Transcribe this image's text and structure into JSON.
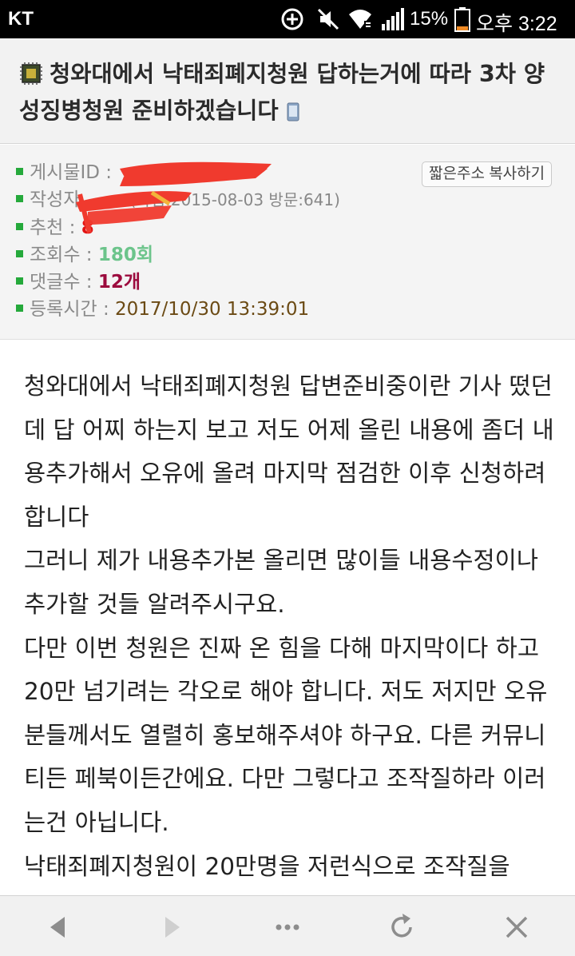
{
  "status_bar": {
    "carrier": "KT",
    "battery_percent": "15%",
    "time": "오후 3:22",
    "icons": [
      "data-saver-icon",
      "mute-icon",
      "wifi-icon",
      "signal-icon",
      "battery-icon"
    ]
  },
  "post": {
    "title": "청와대에서 낙태죄폐지청원 답하는거에 따라 3차 양성징병청원 준비하겠습니다",
    "meta": {
      "post_id_label": "게시물ID :",
      "author_label": "작성자",
      "author_info": "(가입:2015-08-03 방문:641)",
      "recommend_label": "추천 :",
      "recommend_value": "8",
      "views_label": "조회수 :",
      "views_value": "180회",
      "comments_label": "댓글수 :",
      "comments_value": "12개",
      "date_label": "등록시간 :",
      "date_value": "2017/10/30 13:39:01",
      "short_url_button": "짧은주소 복사하기"
    },
    "body_paragraphs": [
      "청와대에서 낙태죄폐지청원 답변준비중이란 기사 떴던데 답 어찌 하는지 보고 저도 어제 올린 내용에 좀더 내용추가해서  오유에 올려 마지막 점검한 이후 신청하려 합니다",
      "그러니  제가 내용추가본  올리면 많이들 내용수정이나 추가할 것들 알려주시구요.",
      "다만 이번 청원은  진짜 온 힘을 다해 마지막이다 하고 20만 넘기려는 각오로 해야 합니다. 저도 저지만 오유분들께서도 열렬히 홍보해주셔야 하구요.  다른 커뮤니티든 페북이든간에요. 다만 그렇다고 조작질하라 이러는건 아닙니다.",
      "낙태죄폐지청원이 20만명을 저런식으로 조작질을"
    ]
  },
  "bottom_bar": {
    "buttons": [
      "back-icon",
      "forward-icon",
      "more-icon",
      "refresh-icon",
      "close-icon"
    ]
  },
  "colors": {
    "bullet": "#25a93b",
    "recommend": "#e21313",
    "views": "#6cc48b",
    "comments": "#9c0b3e",
    "date": "#6b4a14",
    "redaction": "#f03a2e"
  }
}
